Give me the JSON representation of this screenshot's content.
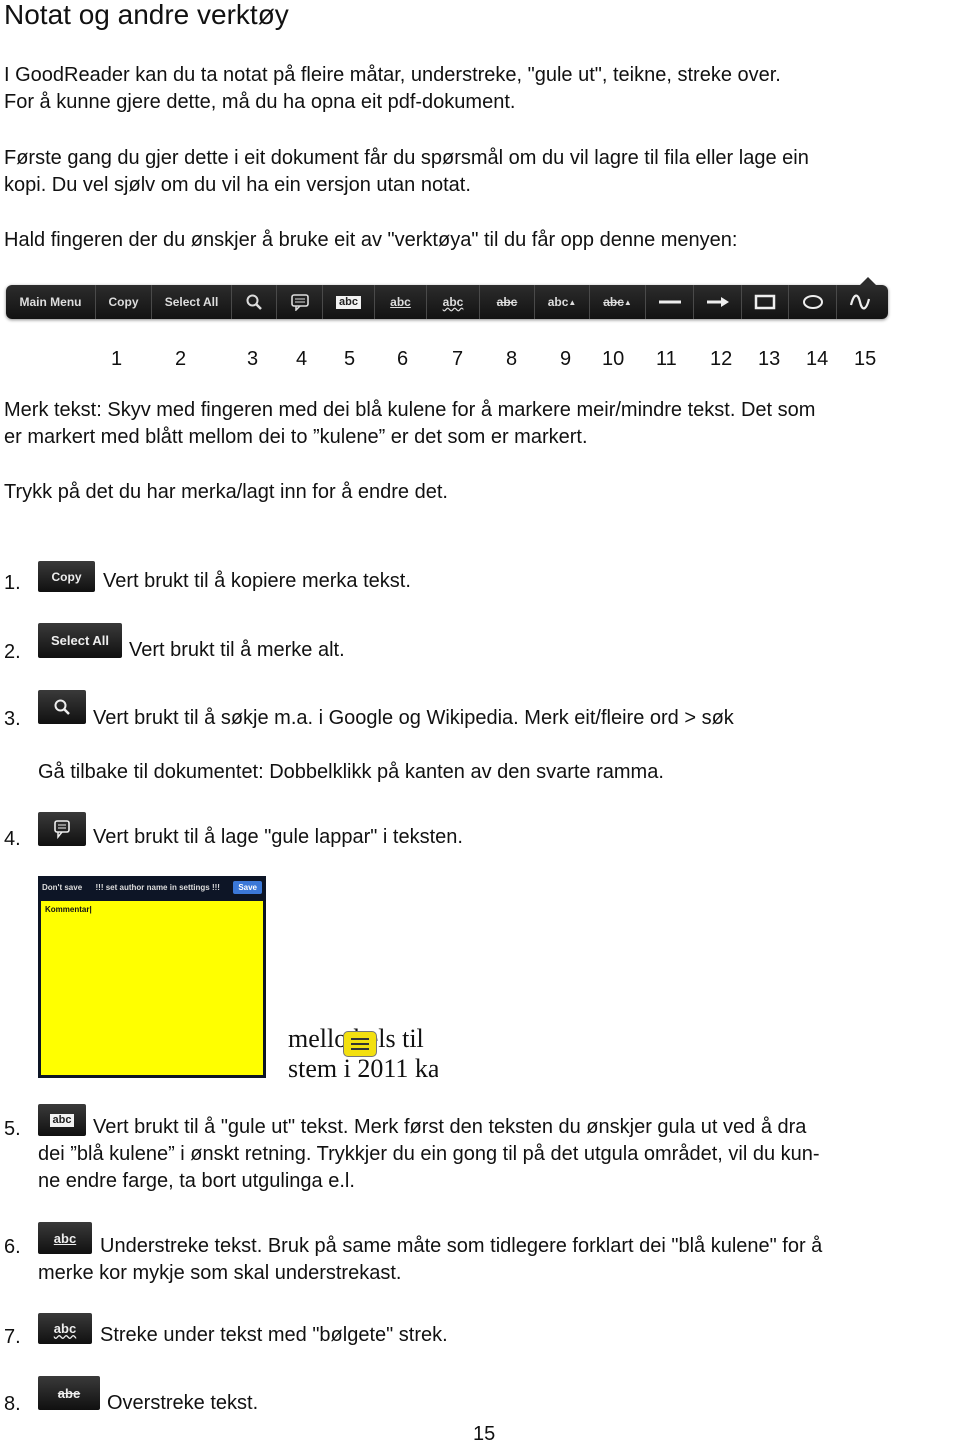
{
  "title": "Notat og andre verktøy",
  "intro": {
    "p1_line1": "I GoodReader kan du ta notat på fleire måtar, understreke, \"gule ut\", teikne, streke over.",
    "p1_line2": "For å kunne gjere dette, må du ha opna eit pdf-dokument.",
    "p2_line1": "Første gang du gjer dette i eit dokument får du spørsmål om du vil lagre til fila eller lage ein",
    "p2_line2": "kopi. Du vel sjølv om du vil ha ein versjon utan notat.",
    "p3": "Hald fingeren der du ønskjer å bruke eit av \"verktøya\" til du får opp denne menyen:"
  },
  "toolbar": {
    "items": [
      {
        "label": "Main Menu",
        "icon": "text"
      },
      {
        "label": "Copy",
        "icon": "text"
      },
      {
        "label": "Select All",
        "icon": "text"
      },
      {
        "label": "",
        "icon": "search-icon"
      },
      {
        "label": "",
        "icon": "note-icon"
      },
      {
        "label": "abc",
        "icon": "highlight-icon"
      },
      {
        "label": "abc",
        "icon": "underline-icon"
      },
      {
        "label": "abc",
        "icon": "squiggly-icon"
      },
      {
        "label": "abc",
        "icon": "strikeout-icon"
      },
      {
        "label": "abc",
        "icon": "text-insert-icon"
      },
      {
        "label": "abc",
        "icon": "text-replace-icon"
      },
      {
        "label": "",
        "icon": "line-icon"
      },
      {
        "label": "",
        "icon": "arrow-icon"
      },
      {
        "label": "",
        "icon": "rectangle-icon"
      },
      {
        "label": "",
        "icon": "oval-icon"
      },
      {
        "label": "",
        "icon": "freehand-icon"
      }
    ],
    "numbers": [
      "1",
      "2",
      "3",
      "4",
      "5",
      "6",
      "7",
      "8",
      "9",
      "10",
      "11",
      "12",
      "13",
      "14",
      "15"
    ]
  },
  "merk": {
    "line1": "Merk tekst: Skyv med fingeren med dei blå kulene for å markere meir/mindre tekst. Det som",
    "line2": "er markert med blått mellom dei to ”kulene” er det som er markert.",
    "trykk": "Trykk på det du har merka/lagt inn for å endre det."
  },
  "list": [
    {
      "num": "1.",
      "icon_label": "Copy",
      "text": "Vert brukt til å kopiere merka tekst."
    },
    {
      "num": "2.",
      "icon_label": "Select All",
      "text": "Vert brukt til å merke alt."
    },
    {
      "num": "3.",
      "icon_label": "",
      "text": "Vert brukt til å søkje m.a. i Google og Wikipedia. Merk eit/fleire ord > søk"
    },
    {
      "num": "4.",
      "icon_label": "",
      "text": "Vert brukt til å lage \"gule lappar\" i teksten."
    },
    {
      "num": "5.",
      "icon_label": "abc",
      "text_line1": "Vert brukt til å \"gule ut\" tekst. Merk først den teksten du ønskjer gula ut ved å dra",
      "text_line2": "dei ”blå kulene” i ønskt retning. Trykkjer du ein gong til på det utgula området, vil du kun-",
      "text_line3": "ne endre farge, ta bort utgulinga e.l."
    },
    {
      "num": "6.",
      "icon_label": "abc",
      "text_line1": "Understreke tekst. Bruk på same måte som tidlegere forklart dei \"blå kulene\" for å",
      "text_line2": "merke kor mykje som skal understrekast."
    },
    {
      "num": "7.",
      "icon_label": "abc",
      "text": "Streke under tekst med \"bølgete\" strek."
    },
    {
      "num": "8.",
      "icon_label": "abe",
      "text": "Overstreke tekst."
    }
  ],
  "back_note": "Gå tilbake til dokumentet: Dobbelklikk på kanten av den svarte ramma.",
  "note_screenshot": {
    "dont_save": "Don't save",
    "author": "!!! set author name in settings !!!",
    "save": "Save",
    "body": "Kommentar",
    "snippet_line1": "mello   bels til",
    "snippet_line2": "stem i 2011 ka"
  },
  "page_number": "15"
}
